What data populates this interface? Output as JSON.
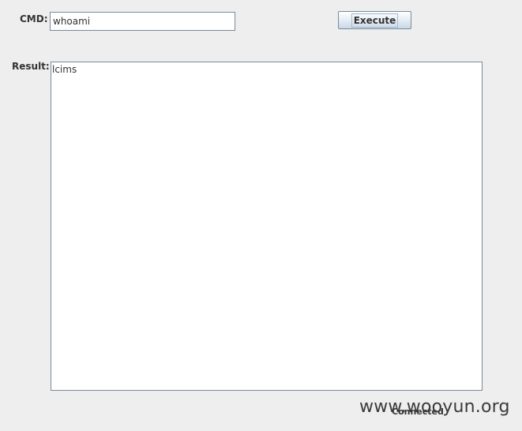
{
  "form": {
    "cmd_label": "CMD:",
    "cmd_value": "whoami",
    "execute_label": "Execute",
    "result_label": "Result:",
    "result_text": "lcims"
  },
  "status": {
    "text": "Connected"
  },
  "watermark": {
    "text": "www.wooyun.org"
  }
}
